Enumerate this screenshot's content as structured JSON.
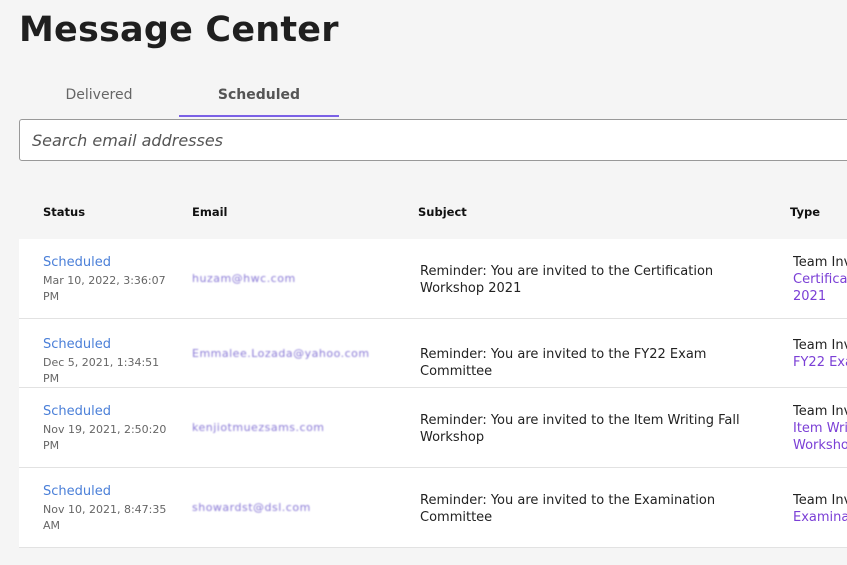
{
  "page_title": "Message Center",
  "tabs": [
    {
      "label": "Delivered",
      "active": false
    },
    {
      "label": "Scheduled",
      "active": true
    }
  ],
  "search": {
    "placeholder": "Search email addresses",
    "value": ""
  },
  "table": {
    "columns": [
      "Status",
      "Email",
      "Subject",
      "Type"
    ],
    "rows": [
      {
        "status": "Scheduled",
        "date": "Mar 10, 2022, 3:36:07 PM",
        "email": "hu­zam@hwc.com",
        "subject": "Reminder: You are invited to the Certification Workshop 2021",
        "type_label": "Team Inv",
        "type_link": "Certificat 2021"
      },
      {
        "status": "Scheduled",
        "date": "Dec 5, 2021, 1:34:51 PM",
        "email": "Emmalee.Lozada@yahoo.com",
        "subject": "Reminder: You are invited to the FY22 Exam Committee",
        "type_label": "Team Inv",
        "type_link": "FY22 Exa"
      },
      {
        "status": "Scheduled",
        "date": "Nov 19, 2021, 2:50:20 PM",
        "email": "kenjiotmuezsams.com",
        "subject": "Reminder: You are invited to the Item Writing Fall Workshop",
        "type_label": "Team Inv",
        "type_link": "Item Writ Worksho"
      },
      {
        "status": "Scheduled",
        "date": "Nov 10, 2021, 8:47:35 AM",
        "email": "showardst@dsl.com",
        "subject": "Reminder: You are invited to the Examination Committee",
        "type_label": "Team Inv",
        "type_link": "Examinat"
      }
    ]
  },
  "colors": {
    "accent": "#7b61e6",
    "status": "#4a7fd8",
    "link": "#7b3fd6"
  }
}
